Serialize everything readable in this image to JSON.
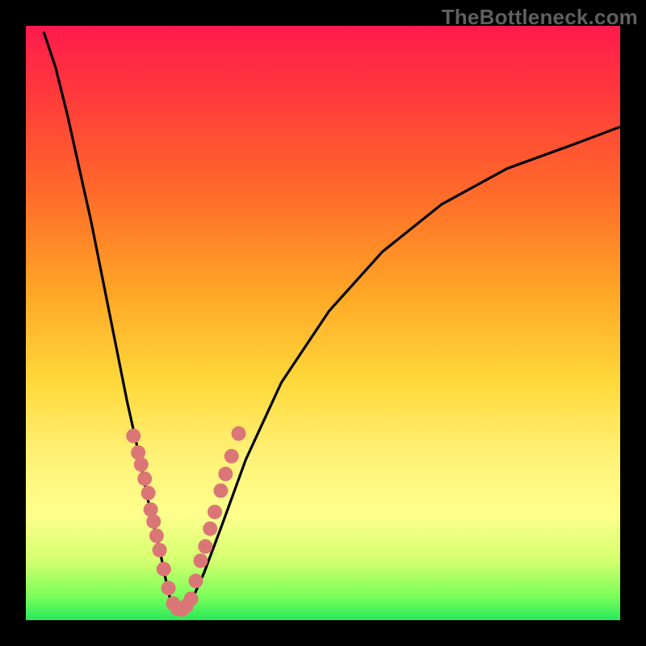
{
  "watermark": "TheBottleneck.com",
  "chart_data": {
    "type": "line",
    "title": "",
    "xlabel": "",
    "ylabel": "",
    "xlim": [
      0,
      100
    ],
    "ylim": [
      0,
      100
    ],
    "note": "Two black curves descend from the top and meet near bottom-center. Axes are not labeled numerically; x/y are normalized 0–100. Pink dots cluster along both branches near the V-shaped minimum. Values are estimated from pixel positions.",
    "series": [
      {
        "name": "left-branch",
        "x": [
          3,
          5,
          7,
          9,
          11,
          13,
          15,
          17,
          19,
          21,
          22.5,
          23.5,
          24.3,
          25
        ],
        "y": [
          99,
          93,
          85,
          76,
          67,
          57,
          47,
          37,
          28,
          18,
          12,
          7,
          3.5,
          2
        ]
      },
      {
        "name": "right-branch",
        "x": [
          27,
          28.2,
          30,
          33,
          37,
          43,
          51,
          60,
          70,
          81,
          92,
          100
        ],
        "y": [
          2,
          4,
          8,
          16,
          27,
          40,
          52,
          62,
          70,
          76,
          80,
          83
        ]
      },
      {
        "name": "floor",
        "x": [
          25,
          25.5,
          26,
          26.5,
          27
        ],
        "y": [
          2,
          1.7,
          1.6,
          1.7,
          2
        ]
      }
    ],
    "dots": {
      "name": "scatter-points",
      "color": "#db7676",
      "points": [
        [
          18.1,
          31.0
        ],
        [
          18.9,
          28.2
        ],
        [
          19.4,
          26.2
        ],
        [
          20.0,
          23.8
        ],
        [
          20.6,
          21.4
        ],
        [
          21.0,
          18.6
        ],
        [
          21.5,
          16.6
        ],
        [
          22.0,
          14.2
        ],
        [
          22.5,
          11.8
        ],
        [
          23.2,
          8.6
        ],
        [
          24.0,
          5.4
        ],
        [
          24.8,
          2.8
        ],
        [
          25.5,
          1.9
        ],
        [
          26.3,
          1.8
        ],
        [
          27.0,
          2.4
        ],
        [
          27.8,
          3.6
        ],
        [
          28.6,
          6.6
        ],
        [
          29.4,
          10.0
        ],
        [
          30.2,
          12.4
        ],
        [
          31.0,
          15.4
        ],
        [
          31.8,
          18.2
        ],
        [
          32.8,
          21.8
        ],
        [
          33.6,
          24.6
        ],
        [
          34.6,
          27.6
        ],
        [
          35.8,
          31.4
        ]
      ]
    },
    "gradient_bands": {
      "note": "Background vertical gradient encodes bottleneck severity. Approximate percent-of-height stops.",
      "stops": [
        {
          "pos": 0,
          "color": "#ff1a4d"
        },
        {
          "pos": 12,
          "color": "#ff3b3b"
        },
        {
          "pos": 28,
          "color": "#ff6a2a"
        },
        {
          "pos": 45,
          "color": "#ffa726"
        },
        {
          "pos": 60,
          "color": "#ffd93b"
        },
        {
          "pos": 72,
          "color": "#fff176"
        },
        {
          "pos": 82,
          "color": "#ffff8d"
        },
        {
          "pos": 90,
          "color": "#d4ff70"
        },
        {
          "pos": 96,
          "color": "#7aff5a"
        },
        {
          "pos": 100,
          "color": "#29e85b"
        }
      ]
    }
  }
}
